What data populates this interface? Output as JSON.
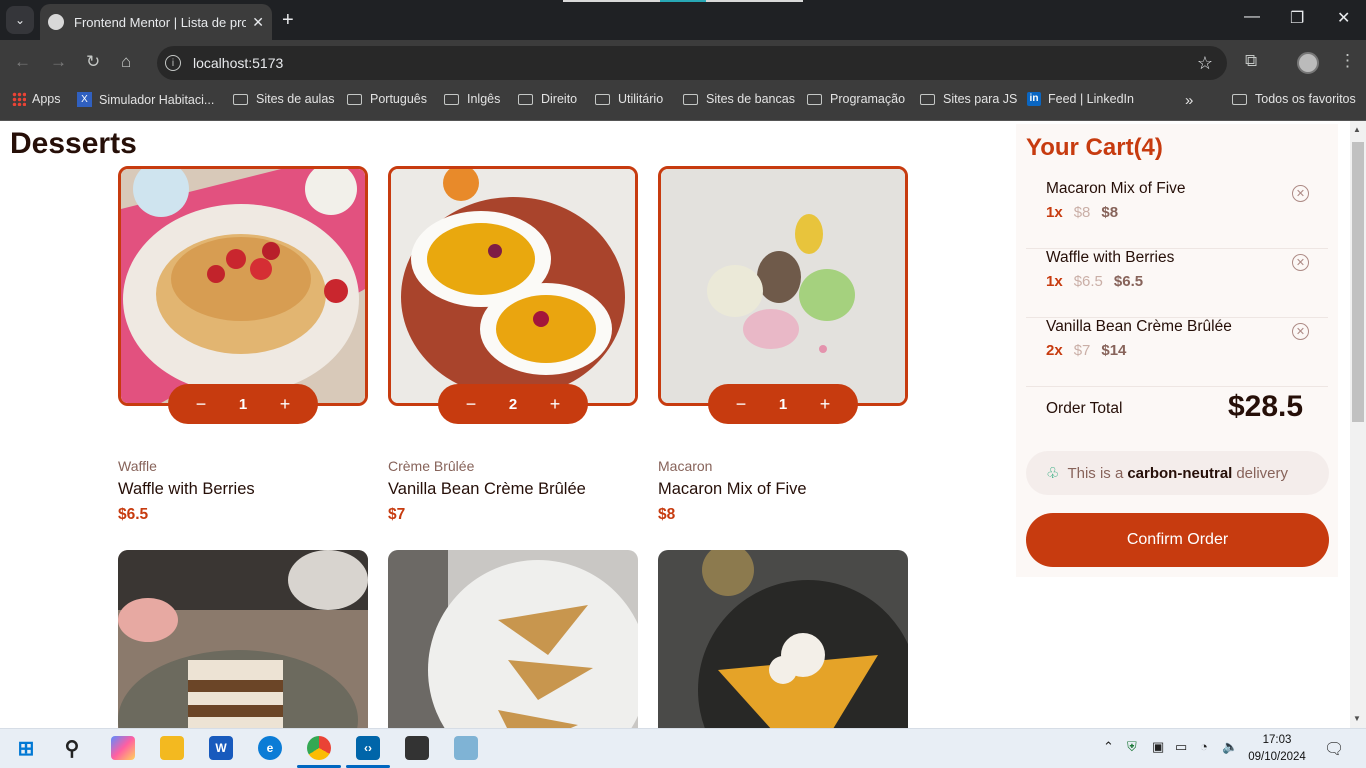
{
  "browser": {
    "tab_title": "Frontend Mentor | Lista de produtos",
    "url": "localhost:5173",
    "bookmarks": [
      {
        "label": "Apps"
      },
      {
        "label": "Simulador Habitaci..."
      },
      {
        "label": "Sites de aulas"
      },
      {
        "label": "Português"
      },
      {
        "label": "Inlgês"
      },
      {
        "label": "Direito"
      },
      {
        "label": "Utilitário"
      },
      {
        "label": "Sites de bancas"
      },
      {
        "label": "Programação"
      },
      {
        "label": "Sites para JS"
      },
      {
        "label": "Feed | LinkedIn"
      },
      {
        "label": "Todos os favoritos"
      }
    ]
  },
  "page": {
    "heading": "Desserts",
    "products": [
      {
        "category": "Waffle",
        "name": "Waffle with Berries",
        "price": "$6.5",
        "qty": "1",
        "selected": true
      },
      {
        "category": "Crème Brûlée",
        "name": "Vanilla Bean Crème Brûlée",
        "price": "$7",
        "qty": "2",
        "selected": true
      },
      {
        "category": "Macaron",
        "name": "Macaron Mix of Five",
        "price": "$8",
        "qty": "1",
        "selected": true
      },
      {
        "category": "",
        "name": "",
        "price": "",
        "qty": "",
        "selected": false
      },
      {
        "category": "",
        "name": "",
        "price": "",
        "qty": "",
        "selected": false
      },
      {
        "category": "",
        "name": "",
        "price": "",
        "qty": "",
        "selected": false
      }
    ]
  },
  "cart": {
    "title": "Your Cart(4)",
    "items": [
      {
        "name": "Macaron Mix of Five",
        "qty": "1x",
        "unit": "$8",
        "total": "$8"
      },
      {
        "name": "Waffle with Berries",
        "qty": "1x",
        "unit": "$6.5",
        "total": "$6.5"
      },
      {
        "name": "Vanilla Bean Crème Brûlée",
        "qty": "2x",
        "unit": "$7",
        "total": "$14"
      }
    ],
    "order_total_label": "Order Total",
    "order_total": "$28.5",
    "carbon_pre": "This is a",
    "carbon_bold": "carbon-neutral",
    "carbon_post": "delivery",
    "confirm_label": "Confirm Order"
  },
  "taskbar": {
    "time": "17:03",
    "date": "09/10/2024"
  },
  "colors": {
    "accent": "#c73b0f",
    "text_dark": "#260f08",
    "cart_bg": "#fcf8f6"
  }
}
